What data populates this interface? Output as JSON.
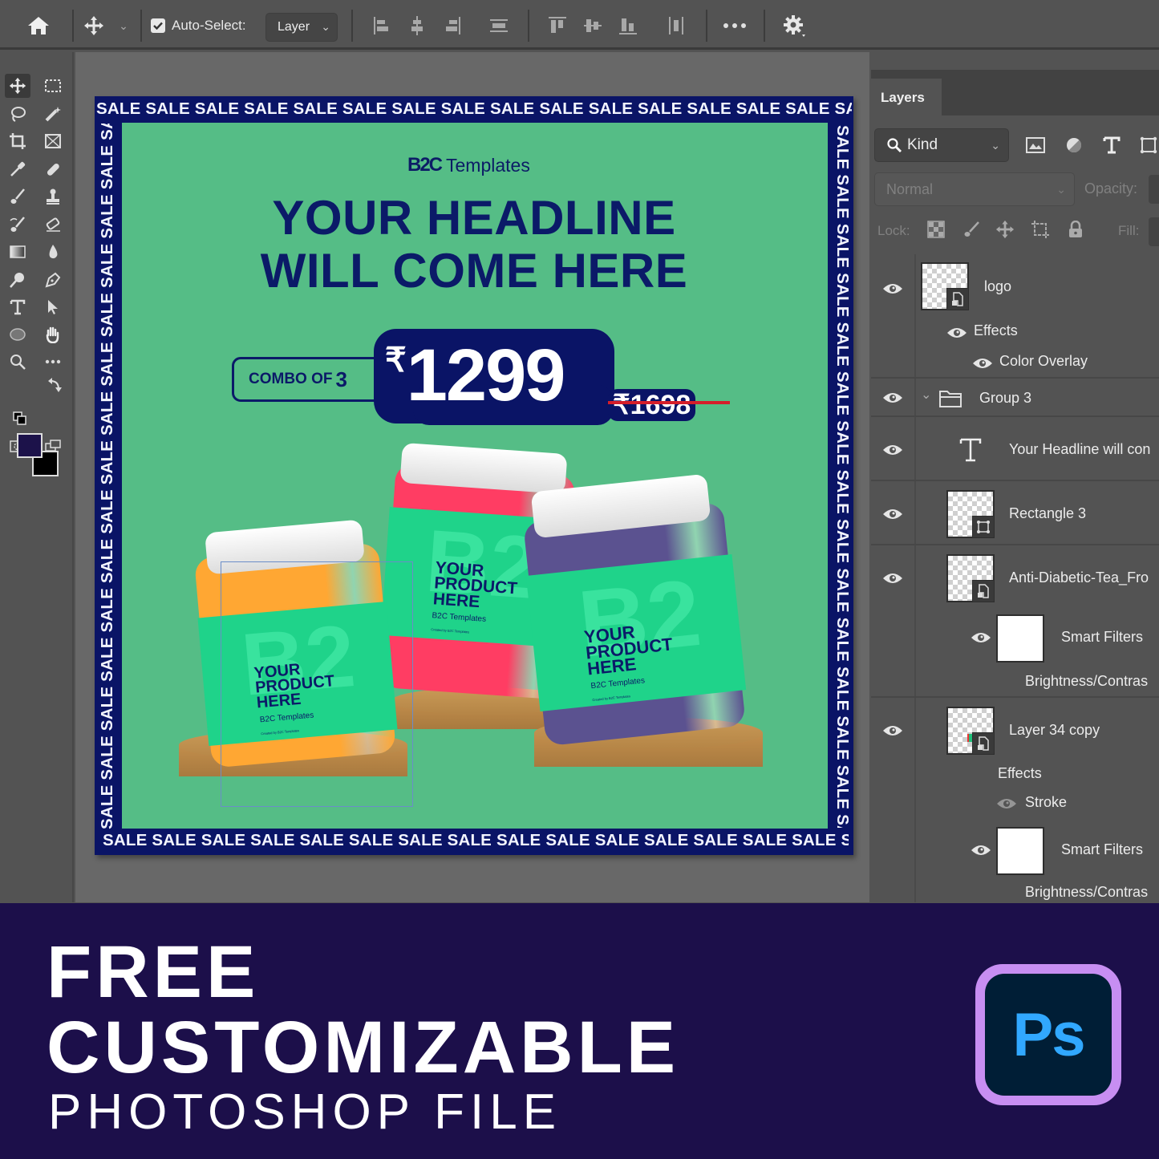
{
  "options_bar": {
    "home_icon": "home-icon",
    "move_tool_icon": "move-icon",
    "auto_select_checked": true,
    "auto_select_label": "Auto-Select:",
    "auto_select_target": "Layer",
    "align_icons": [
      "align-left-edges",
      "align-horizontal-centers",
      "align-right-edges",
      "distribute-vertical",
      "align-top-edges",
      "align-vertical-centers",
      "align-bottom-edges",
      "distribute-horizontal"
    ],
    "more_icon": "more-icon",
    "settings_icon": "gear-icon"
  },
  "toolbox": {
    "tools": [
      "move",
      "rectangular-marquee",
      "lasso",
      "magic-wand",
      "crop",
      "frame",
      "eyedropper",
      "spot-healing",
      "brush",
      "clone-stamp",
      "history-brush",
      "eraser",
      "gradient",
      "blur",
      "dodge",
      "pen",
      "type",
      "path-selection",
      "ellipse",
      "hand",
      "zoom",
      "edit-toolbar"
    ],
    "foreground_color": "#1c124a",
    "background_color": "#000000"
  },
  "canvas": {
    "border_word": "SALE",
    "border_color": "#0a1466",
    "background_color": "#55bd86",
    "brand": {
      "mark": "B2C",
      "name": "Templates"
    },
    "headline_line1": "YOUR HEADLINE",
    "headline_line2": "WILL COME HERE",
    "combo_label": "COMBO OF",
    "combo_count": "3",
    "currency": "₹",
    "price": "1299",
    "old_price": "₹1698",
    "products": [
      {
        "jar_color": "#ffa733",
        "label_line1": "YOUR",
        "label_line2": "PRODUCT",
        "label_line3": "HERE",
        "label_brand": "B2C Templates",
        "label_fine": "Created by B2C Templates"
      },
      {
        "jar_color": "#ff3d63",
        "label_line1": "YOUR",
        "label_line2": "PRODUCT",
        "label_line3": "HERE",
        "label_brand": "B2C Templates",
        "label_fine": "Created by B2C Templates"
      },
      {
        "jar_color": "#5b5290",
        "label_line1": "YOUR",
        "label_line2": "PRODUCT",
        "label_line3": "HERE",
        "label_brand": "B2C Templates",
        "label_fine": "Created by B2C Templates"
      }
    ]
  },
  "layers_panel": {
    "tab": "Layers",
    "filter_kind": "Kind",
    "blend_mode": "Normal",
    "opacity_label": "Opacity:",
    "lock_label": "Lock:",
    "fill_label": "Fill:",
    "layers": [
      {
        "name": "logo",
        "type": "smart-object",
        "visible": true
      },
      {
        "name": "Effects",
        "type": "effects",
        "visible": true
      },
      {
        "name": "Color Overlay",
        "type": "effect",
        "visible": true
      },
      {
        "name": "Group 3",
        "type": "group",
        "visible": true,
        "expanded": true
      },
      {
        "name": "Your Headline will con",
        "type": "text",
        "visible": true
      },
      {
        "name": "Rectangle 3",
        "type": "shape",
        "visible": true
      },
      {
        "name": "Anti-Diabetic-Tea_Fro",
        "type": "smart-object",
        "visible": true
      },
      {
        "name": "Smart Filters",
        "type": "smart-filters",
        "visible": true
      },
      {
        "name": "Brightness/Contras",
        "type": "filter"
      },
      {
        "name": "Layer 34 copy",
        "type": "smart-object",
        "visible": true
      },
      {
        "name": "Effects",
        "type": "effects"
      },
      {
        "name": "Stroke",
        "type": "effect",
        "visible": false
      },
      {
        "name": "Smart Filters",
        "type": "smart-filters",
        "visible": true
      },
      {
        "name": "Brightness/Contras",
        "type": "filter"
      }
    ]
  },
  "banner": {
    "line1": "FREE",
    "line2": "CUSTOMIZABLE",
    "line3": "PHOTOSHOP FILE",
    "app_badge": "Ps",
    "background": "#1c0f4a"
  }
}
